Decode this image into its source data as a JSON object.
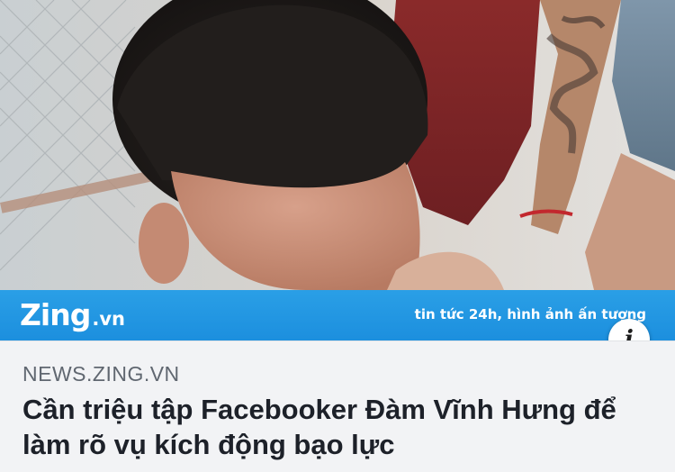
{
  "photo": {
    "icon": "news-photo"
  },
  "banner": {
    "logo_main": "Zing",
    "logo_suffix": ".vn",
    "tagline": "tin tức 24h, hình ảnh ấn tượng",
    "color": "#1e93e0"
  },
  "info_button": {
    "glyph": "i",
    "icon": "info-icon"
  },
  "link_preview": {
    "source": "NEWS.ZING.VN",
    "headline": "Cần triệu tập Facebooker Đàm Vĩnh Hưng để làm rõ vụ kích động bạo lực"
  }
}
